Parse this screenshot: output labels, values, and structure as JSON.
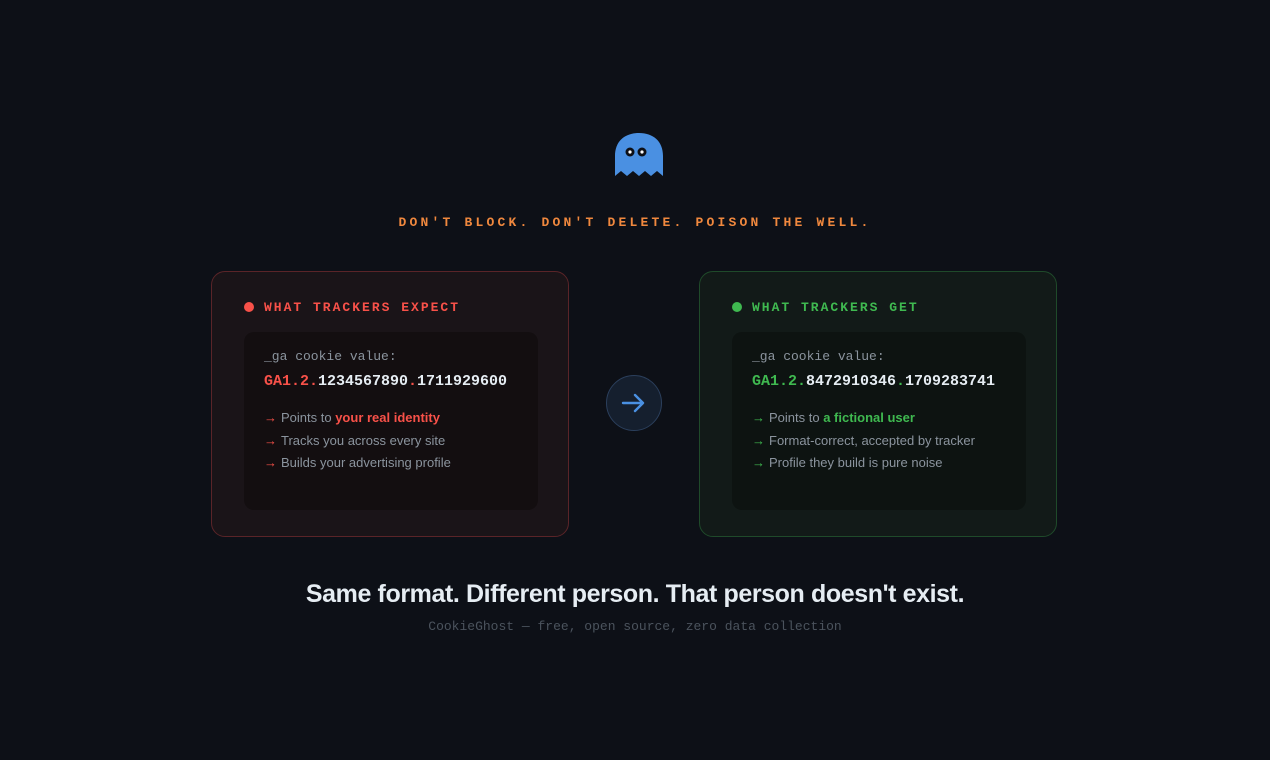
{
  "brand": {
    "logo_icon": "ghost-icon",
    "tagline": "DON'T BLOCK. DON'T DELETE. POISON THE WELL."
  },
  "colors": {
    "background": "#0d1017",
    "accent_orange": "#f0883e",
    "danger_red": "#f85149",
    "success_green": "#3fb950",
    "ghost_blue": "#4a90e2"
  },
  "expect_card": {
    "title": "WHAT TRACKERS EXPECT",
    "cookie_label": "_ga cookie value:",
    "cookie_prefix": "GA1.2.",
    "cookie_id": "1234567890",
    "cookie_sep": ".",
    "cookie_ts": "1711929600",
    "points": [
      {
        "text": "Points to ",
        "emphasis": "your real identity"
      },
      {
        "text": "Tracks you across every site",
        "emphasis": ""
      },
      {
        "text": "Builds your advertising profile",
        "emphasis": ""
      }
    ]
  },
  "transform_icon": "arrow-right-icon",
  "get_card": {
    "title": "WHAT TRACKERS GET",
    "cookie_label": "_ga cookie value:",
    "cookie_prefix": "GA1.2.",
    "cookie_id": "8472910346",
    "cookie_sep": ".",
    "cookie_ts": "1709283741",
    "points": [
      {
        "text": "Points to ",
        "emphasis": "a fictional user"
      },
      {
        "text": "Format-correct, accepted by tracker",
        "emphasis": ""
      },
      {
        "text": "Profile they build is pure noise",
        "emphasis": ""
      }
    ]
  },
  "headline": "Same format. Different person. That person doesn't exist.",
  "footer": "CookieGhost — free, open source, zero data collection",
  "arrow_glyph": "→"
}
